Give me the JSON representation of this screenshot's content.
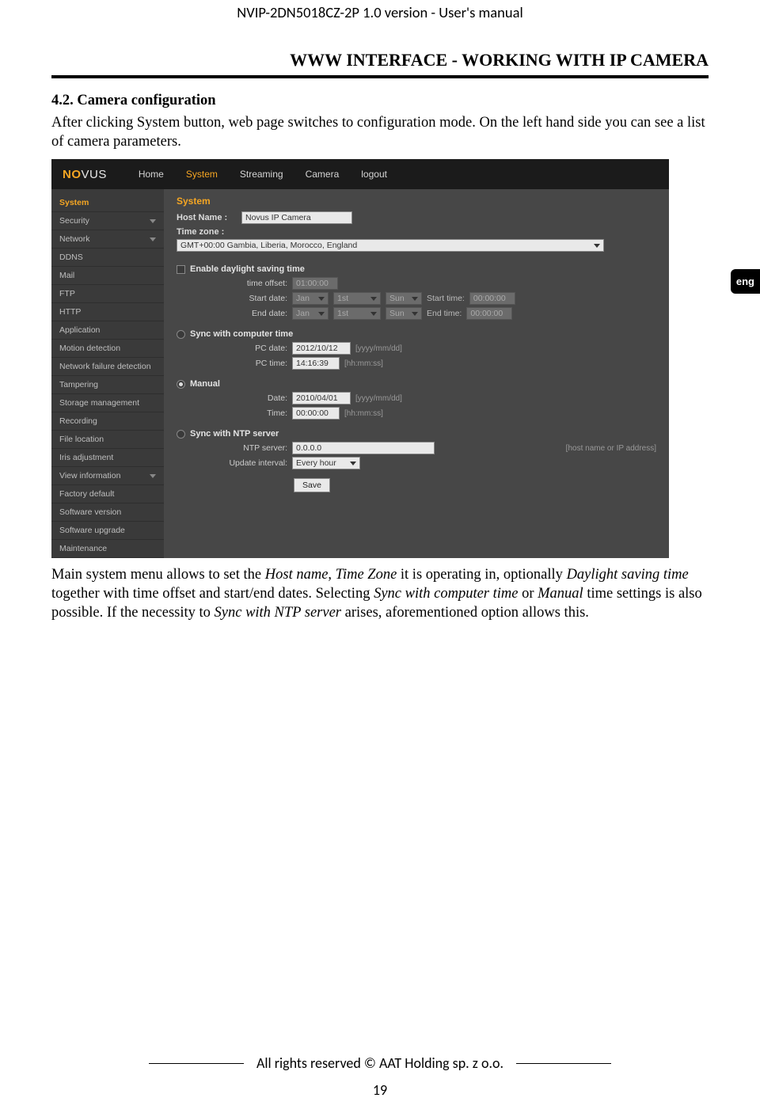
{
  "doc_header": "NVIP-2DN5018CZ-2P 1.0 version - User's manual",
  "section_title": "WWW INTERFACE - WORKING WITH IP CAMERA",
  "lang_tab": "eng",
  "h3": "4.2. Camera configuration",
  "para1": "After clicking System button, web page switches to configuration mode. On the left hand side you can see a list of camera parameters.",
  "para2_parts": {
    "t1": "Main system menu allows to set the ",
    "i1": "Host name",
    "t2": ", ",
    "i2": "Time Zone",
    "t3": " it is operating in, optionally ",
    "i3": "Daylight saving time",
    "t4": " together with time offset and start/end dates. Selecting ",
    "i4": "Sync with computer time",
    "t5": " or ",
    "i5": "Manual",
    "t6": " time settings is also possible. If the necessity to ",
    "i6": "Sync with NTP server",
    "t7": " arises, aforementioned option allows this."
  },
  "footer": "All rights reserved © AAT Holding sp. z o.o.",
  "page_number": "19",
  "shot": {
    "logo_a": "NO",
    "logo_b": "VUS",
    "nav": [
      "Home",
      "System",
      "Streaming",
      "Camera",
      "logout"
    ],
    "nav_active_index": 1,
    "sidebar": [
      {
        "label": "System",
        "active": true
      },
      {
        "label": "Security",
        "arrow": true
      },
      {
        "label": "Network",
        "arrow": true
      },
      {
        "label": "DDNS"
      },
      {
        "label": "Mail"
      },
      {
        "label": "FTP"
      },
      {
        "label": "HTTP"
      },
      {
        "label": "Application"
      },
      {
        "label": "Motion detection"
      },
      {
        "label": "Network failure detection"
      },
      {
        "label": "Tampering"
      },
      {
        "label": "Storage management"
      },
      {
        "label": "Recording"
      },
      {
        "label": "File location"
      },
      {
        "label": "Iris adjustment"
      },
      {
        "label": "View information",
        "arrow": true
      },
      {
        "label": "Factory default"
      },
      {
        "label": "Software version"
      },
      {
        "label": "Software upgrade"
      },
      {
        "label": "Maintenance"
      }
    ],
    "main_title": "System",
    "host_name_label": "Host Name :",
    "host_name_value": "Novus IP Camera",
    "time_zone_label": "Time zone :",
    "time_zone_value": "GMT+00:00 Gambia, Liberia, Morocco, England",
    "dst": {
      "enable_label": "Enable daylight saving time",
      "time_offset_label": "time offset:",
      "time_offset_value": "01:00:00",
      "start_date_label": "Start date:",
      "end_date_label": "End date:",
      "month": "Jan",
      "day": "1st",
      "dow": "Sun",
      "start_time_label": "Start time:",
      "end_time_label": "End time:",
      "time_value": "00:00:00"
    },
    "sync_pc": {
      "title": "Sync with computer time",
      "pc_date_label": "PC date:",
      "pc_date_value": "2012/10/12",
      "date_hint": "[yyyy/mm/dd]",
      "pc_time_label": "PC time:",
      "pc_time_value": "14:16:39",
      "time_hint": "[hh:mm:ss]"
    },
    "manual": {
      "title": "Manual",
      "date_label": "Date:",
      "date_value": "2010/04/01",
      "date_hint": "[yyyy/mm/dd]",
      "time_label": "Time:",
      "time_value": "00:00:00",
      "time_hint": "[hh:mm:ss]"
    },
    "ntp": {
      "title": "Sync with NTP server",
      "server_label": "NTP server:",
      "server_value": "0.0.0.0",
      "server_hint": "[host name or IP address]",
      "interval_label": "Update interval:",
      "interval_value": "Every hour"
    },
    "save_label": "Save"
  }
}
